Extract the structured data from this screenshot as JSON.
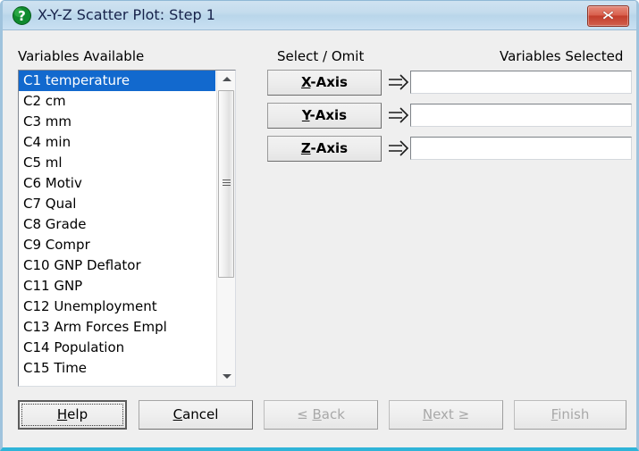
{
  "window": {
    "title": "X-Y-Z Scatter Plot: Step 1",
    "icon": "question-mark-icon",
    "close_label": "Close",
    "accent_titlebar": "#c4dced",
    "accent_close": "#c33d2b",
    "accent_selection": "#1269ce",
    "accent_bottom_edge": "#2fb4d8"
  },
  "available": {
    "header": "Variables Available",
    "items": [
      {
        "label": "C1 temperature",
        "selected": true
      },
      {
        "label": "C2 cm",
        "selected": false
      },
      {
        "label": "C3 mm",
        "selected": false
      },
      {
        "label": "C4 min",
        "selected": false
      },
      {
        "label": "C5 ml",
        "selected": false
      },
      {
        "label": "C6 Motiv",
        "selected": false
      },
      {
        "label": "C7 Qual",
        "selected": false
      },
      {
        "label": "C8 Grade",
        "selected": false
      },
      {
        "label": "C9 Compr",
        "selected": false
      },
      {
        "label": "C10 GNP Deflator",
        "selected": false
      },
      {
        "label": "C11 GNP",
        "selected": false
      },
      {
        "label": "C12 Unemployment",
        "selected": false
      },
      {
        "label": "C13 Arm Forces Empl",
        "selected": false
      },
      {
        "label": "C14 Population",
        "selected": false
      },
      {
        "label": "C15 Time",
        "selected": false
      }
    ],
    "scrollbar": {
      "up_icon": "scroll-up-arrow-icon",
      "down_icon": "scroll-down-arrow-icon",
      "thumb_icon": "scrollbar-thumb-grip-icon"
    }
  },
  "select_omit": {
    "header": "Select / Omit",
    "rows": [
      {
        "button_accel": "X",
        "button_rest": "-Axis",
        "arrow_icon": "double-right-arrow-icon",
        "value": "",
        "placeholder": ""
      },
      {
        "button_accel": "Y",
        "button_rest": "-Axis",
        "arrow_icon": "double-right-arrow-icon",
        "value": "",
        "placeholder": ""
      },
      {
        "button_accel": "Z",
        "button_rest": "-Axis",
        "arrow_icon": "double-right-arrow-icon",
        "value": "",
        "placeholder": ""
      }
    ]
  },
  "selected_panel": {
    "header": "Variables Selected"
  },
  "footer": {
    "help": {
      "accel": "H",
      "rest": "elp",
      "pre": "",
      "disabled": false,
      "default": true
    },
    "cancel": {
      "accel": "C",
      "rest": "ancel",
      "pre": "",
      "disabled": false,
      "default": false
    },
    "back": {
      "accel": "B",
      "rest": "ack",
      "pre": "≤ ",
      "disabled": true,
      "default": false
    },
    "next": {
      "accel": "N",
      "rest": "ext ≥",
      "pre": "",
      "disabled": true,
      "default": false
    },
    "finish": {
      "accel": "F",
      "rest": "inish",
      "pre": "",
      "disabled": true,
      "default": false
    }
  }
}
